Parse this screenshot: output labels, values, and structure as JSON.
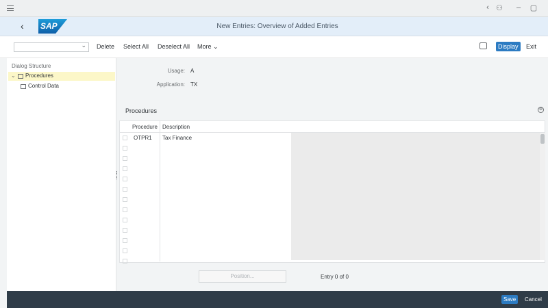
{
  "window": {
    "controls": [
      "‹",
      "⚇",
      "–",
      "▢"
    ]
  },
  "shell": {
    "back": "‹",
    "logo": "SAP",
    "title": "New Entries: Overview of Added Entries"
  },
  "toolbar": {
    "items": [
      "Delete",
      "Select All",
      "Deselect All",
      "More"
    ],
    "more_chevron": "⌄",
    "display": "Display",
    "exit": "Exit"
  },
  "tree": {
    "title": "Dialog Structure",
    "root_label": "Procedures",
    "child_label": "Control Data"
  },
  "fields": {
    "usage_label": "Usage:",
    "usage_value": "A",
    "application_label": "Application:",
    "application_value": "TX"
  },
  "procedures": {
    "title": "Procedures",
    "columns": [
      "Procedure",
      "Description"
    ],
    "rows": [
      {
        "procedure": "OTPR1",
        "description": "Tax Finance"
      }
    ],
    "empty_rows": 12
  },
  "pager": {
    "position_button": "Position...",
    "entry_text": "Entry 0 of 0"
  },
  "bottom": {
    "save": "Save",
    "cancel": "Cancel"
  }
}
